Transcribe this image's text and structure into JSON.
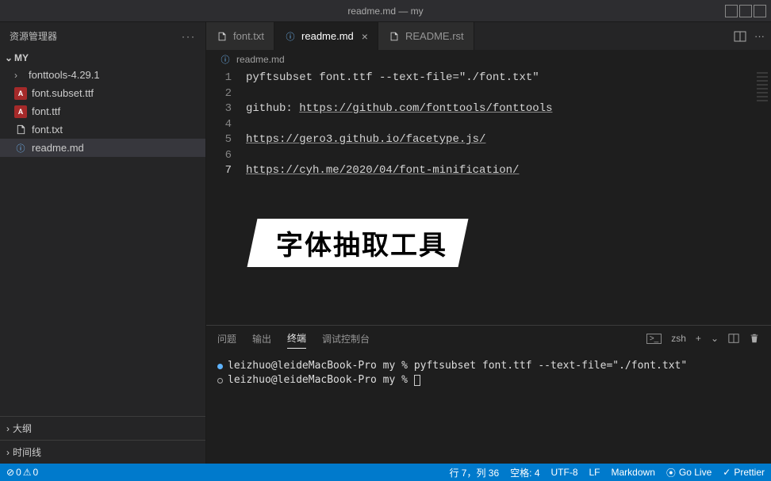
{
  "window": {
    "title": "readme.md — my"
  },
  "sidebar": {
    "title": "资源管理器",
    "root": "MY",
    "items": [
      {
        "label": "fonttools-4.29.1",
        "icon": "folder",
        "chev": "›"
      },
      {
        "label": "font.subset.ttf",
        "icon": "font"
      },
      {
        "label": "font.ttf",
        "icon": "font"
      },
      {
        "label": "font.txt",
        "icon": "txt"
      },
      {
        "label": "readme.md",
        "icon": "info",
        "selected": true
      }
    ],
    "sections": [
      "大纲",
      "时间线"
    ]
  },
  "tabs": [
    {
      "label": "font.txt",
      "icon": "txt"
    },
    {
      "label": "readme.md",
      "icon": "info",
      "active": true,
      "closable": true
    },
    {
      "label": "README.rst",
      "icon": "txt"
    }
  ],
  "breadcrumb": {
    "icon": "info",
    "label": "readme.md"
  },
  "editor": {
    "lines": [
      {
        "n": 1,
        "text": "pyftsubset font.ttf --text-file=\"./font.txt\""
      },
      {
        "n": 2,
        "text": ""
      },
      {
        "n": 3,
        "prefix": "github: ",
        "link": "https://github.com/fonttools/fonttools"
      },
      {
        "n": 4,
        "text": ""
      },
      {
        "n": 5,
        "link": "https://gero3.github.io/facetype.js/"
      },
      {
        "n": 6,
        "text": ""
      },
      {
        "n": 7,
        "link": "https://cyh.me/2020/04/font-minification/",
        "current": true
      }
    ]
  },
  "overlay": "字体抽取工具",
  "panel": {
    "tabs": [
      "问题",
      "输出",
      "终端",
      "调试控制台"
    ],
    "active": 2,
    "shell": "zsh",
    "terminal": {
      "prompt": "leizhuo@leideMacBook-Pro my %",
      "command": "pyftsubset font.ttf --text-file=\"./font.txt\""
    }
  },
  "status": {
    "errors": "0",
    "warnings": "0",
    "cursor": "行 7，列 36",
    "spaces": "空格: 4",
    "encoding": "UTF-8",
    "eol": "LF",
    "lang": "Markdown",
    "golive": "Go Live",
    "prettier": "Prettier"
  }
}
